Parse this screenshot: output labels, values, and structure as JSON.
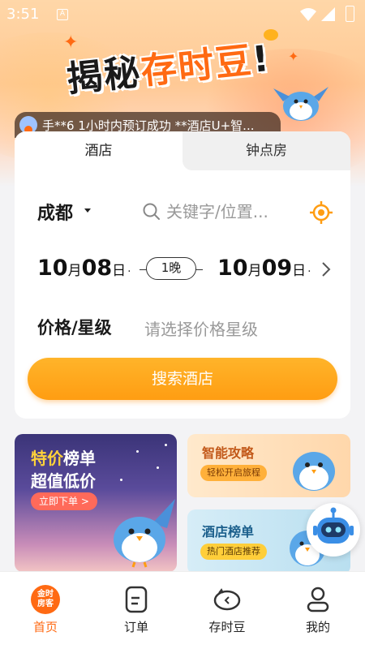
{
  "status_bar": {
    "time": "3:51",
    "sim_label": "A"
  },
  "banner": {
    "title_part1": "揭秘",
    "title_part2": "存时豆",
    "title_part3": "!"
  },
  "ticker": {
    "text": "手**6 1小时内预订成功 **酒店U+智..."
  },
  "tabs": [
    {
      "label": "酒店",
      "active": true
    },
    {
      "label": "钟点房",
      "active": false
    }
  ],
  "search": {
    "city": "成都",
    "keyword_placeholder": "关键字/位置...",
    "checkin": {
      "month": "10",
      "month_unit": "月",
      "day": "08",
      "day_unit": "日",
      "dot": "·"
    },
    "nights": "1晚",
    "checkout": {
      "month": "10",
      "month_unit": "月",
      "day": "09",
      "day_unit": "日",
      "dot": "·"
    },
    "price_label": "价格/星级",
    "price_placeholder": "请选择价格星级",
    "button_label": "搜索酒店"
  },
  "promos": {
    "left": {
      "title_accent": "特价",
      "title_rest": "榜单",
      "subtitle": "超值低价",
      "cta": "立即下单 >"
    },
    "right_top": {
      "title": "智能攻略",
      "tag": "轻松开启旅程"
    },
    "right_bottom": {
      "title": "酒店榜单",
      "tag": "热门酒店推荐"
    }
  },
  "bottom_nav": {
    "home_logo_text": "金时\n房客",
    "items": [
      {
        "label": "首页",
        "icon": "home-logo-icon",
        "active": true
      },
      {
        "label": "订单",
        "icon": "order-icon",
        "active": false
      },
      {
        "label": "存时豆",
        "icon": "piggy-bank-icon",
        "active": false
      },
      {
        "label": "我的",
        "icon": "profile-icon",
        "active": false
      }
    ]
  },
  "colors": {
    "accent": "#ff6a13",
    "button": "#ff9d12",
    "bird_blue": "#5aa7e8"
  }
}
